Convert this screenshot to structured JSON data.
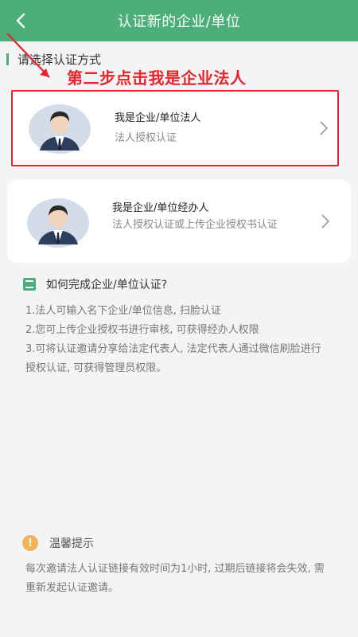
{
  "header": {
    "title": "认证新的企业/单位",
    "back_icon": "chevron-left-icon",
    "bg_color": "#4caf7a"
  },
  "section": {
    "label": "请选择认证方式"
  },
  "annotation": {
    "text": "第二步点击我是企业法人",
    "color": "#e8232a"
  },
  "options": [
    {
      "title": "我是企业/单位法人",
      "subtitle": "法人授权认证"
    },
    {
      "title": "我是企业/单位经办人",
      "subtitle": "法人授权认证或上传企业授权书认证"
    }
  ],
  "howto": {
    "title": "如何完成企业/单位认证?",
    "steps": [
      "1.法人可输入名下企业/单位信息, 扫脸认证",
      "2.您可上传企业授权书进行审核, 可获得经办人权限",
      "3.可将认证邀请分享给法定代表人, 法定代表人通过微信刷脸进行授权认证, 可获得管理员权限。"
    ]
  },
  "tip": {
    "title": "温馨提示",
    "icon_text": "!",
    "body": "每次邀请法人认证链接有效时间为1小时, 过期后链接将会失效, 需重新发起认证邀请。"
  }
}
